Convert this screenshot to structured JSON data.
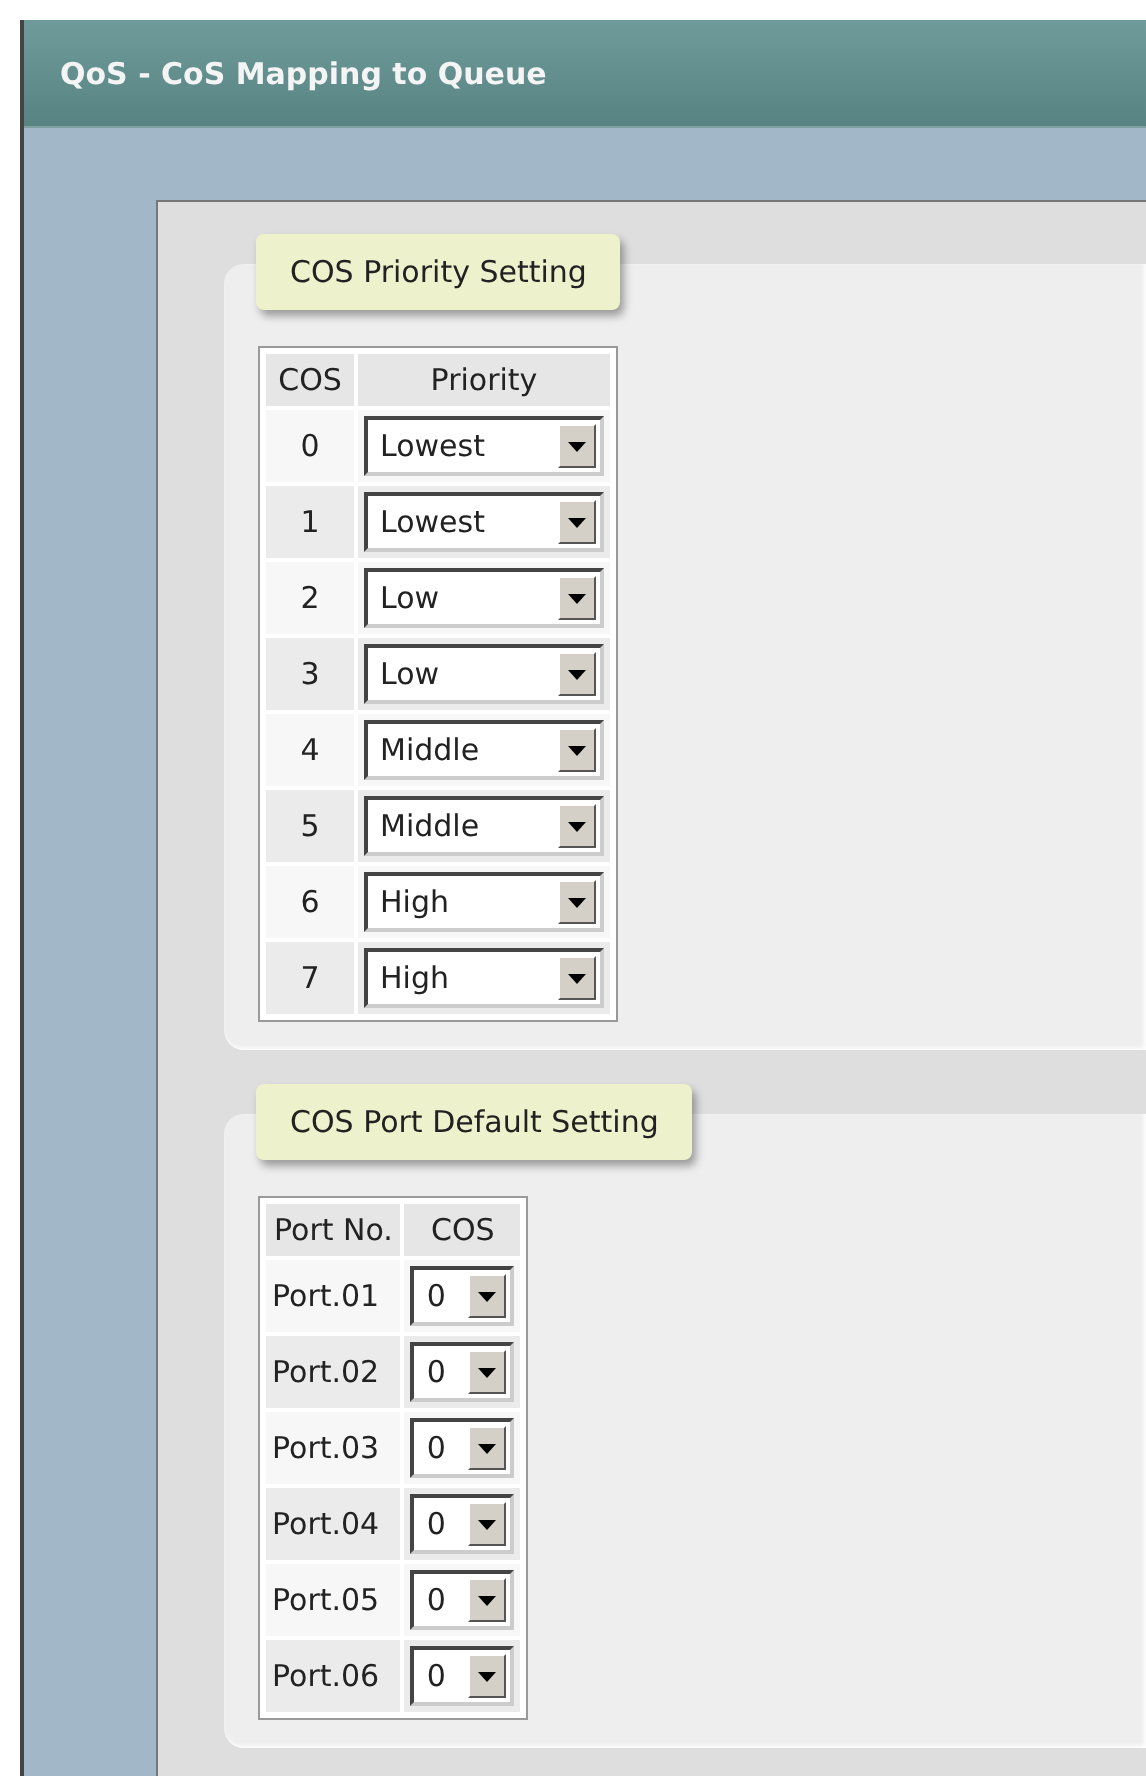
{
  "window": {
    "title": "QoS - CoS Mapping to Queue"
  },
  "priority_setting": {
    "title": "COS Priority Setting",
    "columns": [
      "COS",
      "Priority"
    ],
    "rows": [
      {
        "cos": "0",
        "priority": "Lowest"
      },
      {
        "cos": "1",
        "priority": "Lowest"
      },
      {
        "cos": "2",
        "priority": "Low"
      },
      {
        "cos": "3",
        "priority": "Low"
      },
      {
        "cos": "4",
        "priority": "Middle"
      },
      {
        "cos": "5",
        "priority": "Middle"
      },
      {
        "cos": "6",
        "priority": "High"
      },
      {
        "cos": "7",
        "priority": "High"
      }
    ]
  },
  "port_default_setting": {
    "title": "COS Port Default Setting",
    "columns": [
      "Port No.",
      "COS"
    ],
    "rows": [
      {
        "port": "Port.01",
        "cos": "0"
      },
      {
        "port": "Port.02",
        "cos": "0"
      },
      {
        "port": "Port.03",
        "cos": "0"
      },
      {
        "port": "Port.04",
        "cos": "0"
      },
      {
        "port": "Port.05",
        "cos": "0"
      },
      {
        "port": "Port.06",
        "cos": "0"
      }
    ]
  }
}
